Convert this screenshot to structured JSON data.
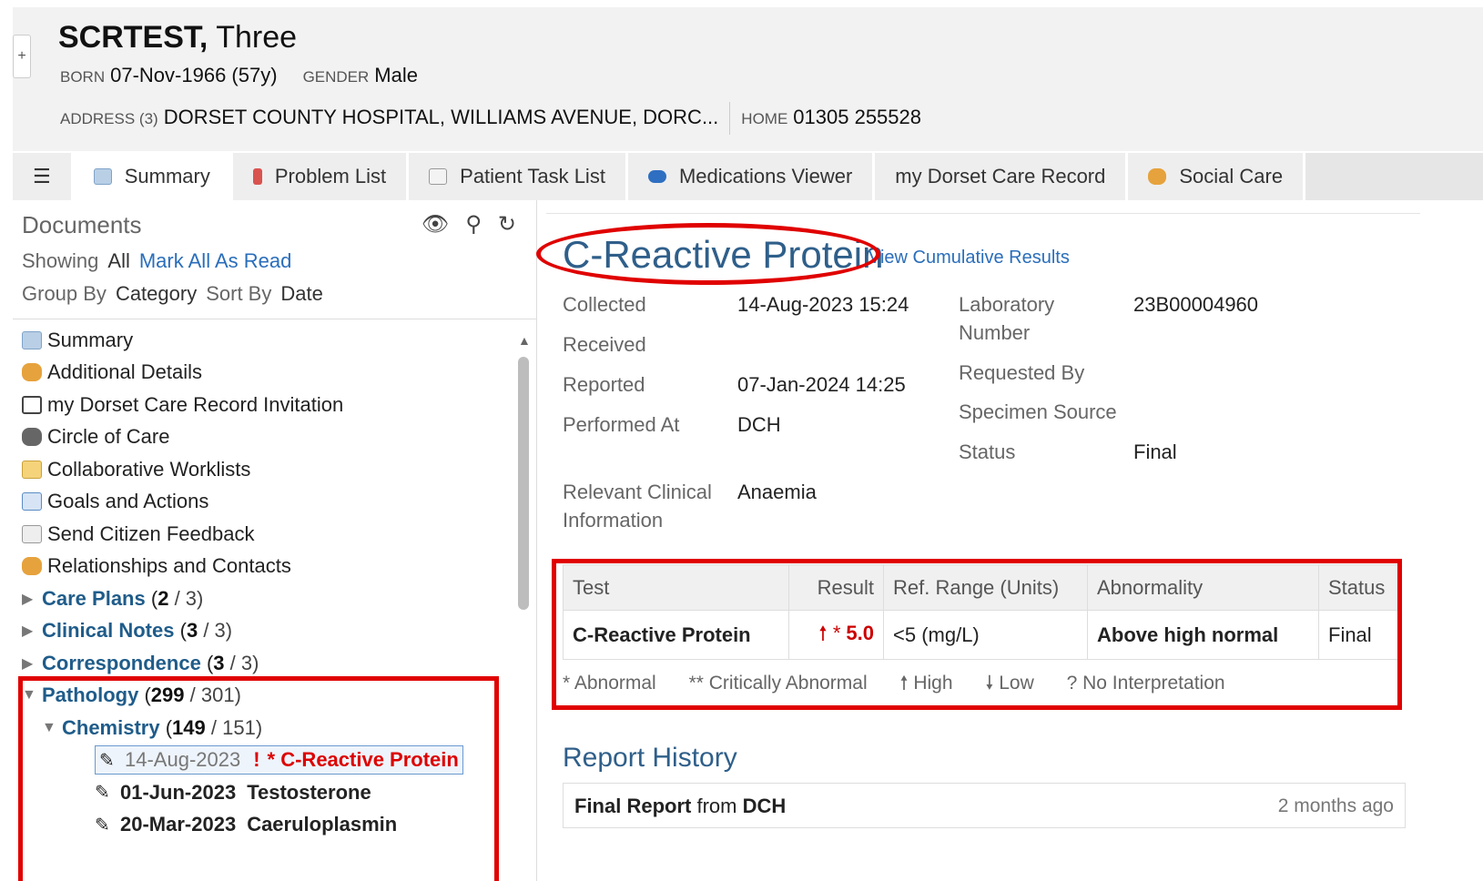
{
  "patient": {
    "surname": "SCRTEST,",
    "forename": "Three",
    "born_label": "BORN",
    "born_value": "07-Nov-1966 (57y)",
    "gender_label": "GENDER",
    "gender_value": "Male",
    "address_label": "ADDRESS (3)",
    "address_value": "DORSET COUNTY HOSPITAL, WILLIAMS AVENUE, DORC...",
    "home_label": "HOME",
    "home_value": "01305 255528"
  },
  "tabs": [
    {
      "label": "Summary",
      "icon": "summary-icon",
      "active": true
    },
    {
      "label": "Problem List",
      "icon": "thermometer-icon"
    },
    {
      "label": "Patient Task List",
      "icon": "task-list-icon"
    },
    {
      "label": "Medications Viewer",
      "icon": "pill-icon"
    },
    {
      "label": "my Dorset Care Record",
      "icon": ""
    },
    {
      "label": "Social Care",
      "icon": "people-icon"
    }
  ],
  "documents": {
    "title": "Documents",
    "showing_label": "Showing",
    "showing_value": "All",
    "mark_all": "Mark All As Read",
    "group_by_label": "Group By",
    "group_by_value": "Category",
    "sort_by_label": "Sort By",
    "sort_by_value": "Date",
    "items": [
      {
        "label": "Summary",
        "icon": "summary-icon"
      },
      {
        "label": "Additional Details",
        "icon": "people-icon"
      },
      {
        "label": "my Dorset Care Record Invitation",
        "icon": "monitor-icon"
      },
      {
        "label": "Circle of Care",
        "icon": "group-icon"
      },
      {
        "label": "Collaborative Worklists",
        "icon": "clipboard-icon"
      },
      {
        "label": "Goals and Actions",
        "icon": "checklist-icon"
      },
      {
        "label": "Send Citizen Feedback",
        "icon": "envelope-icon"
      },
      {
        "label": "Relationships and Contacts",
        "icon": "contacts-icon"
      }
    ],
    "categories": [
      {
        "name": "Care Plans",
        "unread": "2",
        "total": "/ 3)"
      },
      {
        "name": "Clinical Notes",
        "unread": "3",
        "total": "/ 3)"
      },
      {
        "name": "Correspondence",
        "unread": "3",
        "total": "/ 3)"
      },
      {
        "name": "Pathology",
        "unread": "299",
        "total": "/ 301)"
      }
    ],
    "subcategory": {
      "name": "Chemistry",
      "unread": "149",
      "total": "/ 151)"
    },
    "results": [
      {
        "date": "14-Aug-2023",
        "flag": "!",
        "name": "* C-Reactive Protein"
      },
      {
        "date": "01-Jun-2023",
        "name": "Testosterone"
      },
      {
        "date": "20-Mar-2023",
        "name": "Caeruloplasmin"
      }
    ]
  },
  "result": {
    "title": "C-Reactive Protein",
    "cumulative_link": "View Cumulative Results",
    "collected_label": "Collected",
    "collected_value": "14-Aug-2023 15:24",
    "received_label": "Received",
    "reported_label": "Reported",
    "reported_value": "07-Jan-2024 14:25",
    "performed_label": "Performed At",
    "performed_value": "DCH",
    "clinical_label_1": "Relevant Clinical",
    "clinical_label_2": "Information",
    "clinical_value": "Anaemia",
    "lab_label_1": "Laboratory",
    "lab_label_2": "Number",
    "lab_value": "23B00004960",
    "requested_label": "Requested By",
    "specimen_label": "Specimen Source",
    "status_label": "Status",
    "status_value": "Final"
  },
  "table": {
    "headers": [
      "Test",
      "Result",
      "Ref. Range (Units)",
      "Abnormality",
      "Status"
    ],
    "row": {
      "test": "C-Reactive Protein",
      "flag": "🠕 *",
      "value": "5.0",
      "range": "<5 (mg/L)",
      "abnormality": "Above high normal",
      "status": "Final"
    },
    "legend": [
      "* Abnormal",
      "** Critically Abnormal",
      "🠕 High",
      "🠗 Low",
      "? No Interpretation"
    ]
  },
  "history": {
    "title": "Report History",
    "bold1": "Final Report",
    "mid": " from ",
    "bold2": "DCH",
    "time": "2 months ago"
  },
  "colors": {
    "accent": "#2f5f8a",
    "link": "#2a6ebb",
    "abnormal": "#cc0000",
    "annotation": "#e00000"
  }
}
